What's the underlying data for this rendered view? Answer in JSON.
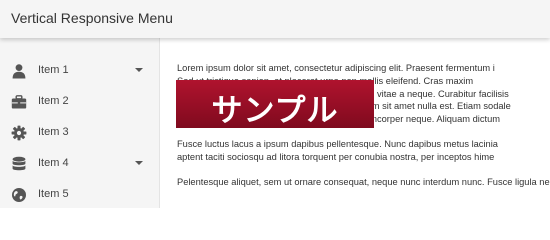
{
  "header": {
    "title": "Vertical Responsive Menu"
  },
  "menu": [
    {
      "label": "Item 1",
      "icon": "user-icon",
      "has_submenu": true
    },
    {
      "label": "Item 2",
      "icon": "briefcase-icon",
      "has_submenu": false
    },
    {
      "label": "Item 3",
      "icon": "gear-icon",
      "has_submenu": false
    },
    {
      "label": "Item 4",
      "icon": "database-icon",
      "has_submenu": true
    },
    {
      "label": "Item 5",
      "icon": "globe-icon",
      "has_submenu": false
    }
  ],
  "content": {
    "paragraphs": [
      [
        "Lorem ipsum dolor sit amet, consectetur adipiscing elit. Praesent fermentum i",
        "Sed ut tristique sapien, at placerat urna non mollis eleifend. Cras maxim",
        "Aenean lacus ante, tempor at dictum, bibendum vitae a neque. Curabitur facilisis",
        "Mauris sagittis lacus a mi et euismod. Vestibulum sit amet nulla est. Etiam sodale",
        "Nunc quis ligula cursus, blandit nulla vitae, ullamcorper neque. Aliquam dictum"
      ],
      [
        "Fusce luctus lacus a ipsum dapibus pellentesque. Nunc dapibus metus lacinia",
        "aptent taciti sociosqu ad litora torquent per conubia nostra, per inceptos hime"
      ],
      [
        "Pelentesque aliquet, sem ut ornare consequat, neque nunc interdum nunc. Fusce ligula nec"
      ]
    ]
  },
  "watermark": {
    "text": "サンプル"
  },
  "colors": {
    "topbar_bg": "#f5f5f5",
    "sidebar_bg": "#f5f5f5",
    "icon_color": "#555555",
    "watermark_bg": "#9b1027",
    "text": "#333333"
  }
}
